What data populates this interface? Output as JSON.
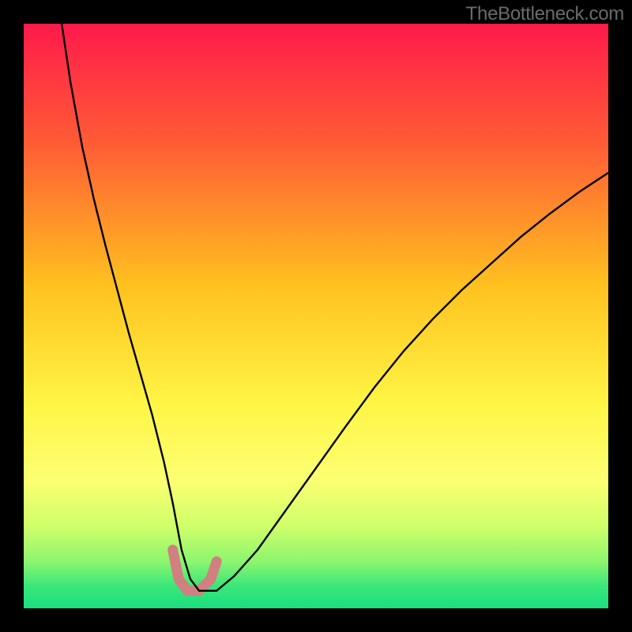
{
  "watermark": "TheBottleneck.com",
  "chart_data": {
    "type": "line",
    "title": "",
    "xlabel": "",
    "ylabel": "",
    "xlim": [
      0,
      100
    ],
    "ylim": [
      0,
      100
    ],
    "legend": false,
    "grid": false,
    "background_gradient": {
      "stops": [
        {
          "offset": 0.0,
          "color": "#ff1a4b"
        },
        {
          "offset": 0.2,
          "color": "#ff5a36"
        },
        {
          "offset": 0.45,
          "color": "#ffc21f"
        },
        {
          "offset": 0.65,
          "color": "#fff545"
        },
        {
          "offset": 0.78,
          "color": "#fcff72"
        },
        {
          "offset": 0.86,
          "color": "#cfff6a"
        },
        {
          "offset": 0.92,
          "color": "#8cf56e"
        },
        {
          "offset": 0.96,
          "color": "#3de778"
        },
        {
          "offset": 1.0,
          "color": "#18df7f"
        }
      ]
    },
    "series": [
      {
        "name": "curve",
        "stroke": "#000000",
        "stroke_width": 2.4,
        "x": [
          6.5,
          8,
          10,
          12,
          14,
          16,
          18,
          20,
          22,
          24,
          25.5,
          27,
          28.5,
          30,
          33,
          36,
          40,
          45,
          50,
          55,
          60,
          65,
          70,
          75,
          80,
          85,
          90,
          95,
          100
        ],
        "y": [
          100,
          90,
          79,
          70,
          62,
          54.5,
          47,
          40,
          33,
          25,
          18,
          10,
          5,
          3,
          3,
          5.5,
          10,
          17,
          24,
          31,
          37.8,
          44,
          49.5,
          54.5,
          59,
          63.5,
          67.5,
          71.2,
          74.5
        ]
      },
      {
        "name": "well-highlight",
        "stroke": "#d08080",
        "stroke_width": 13,
        "linecap": "round",
        "x": [
          25.5,
          26.5,
          28,
          30,
          32,
          33
        ],
        "y": [
          10,
          5,
          3,
          3,
          5,
          8
        ]
      }
    ]
  }
}
